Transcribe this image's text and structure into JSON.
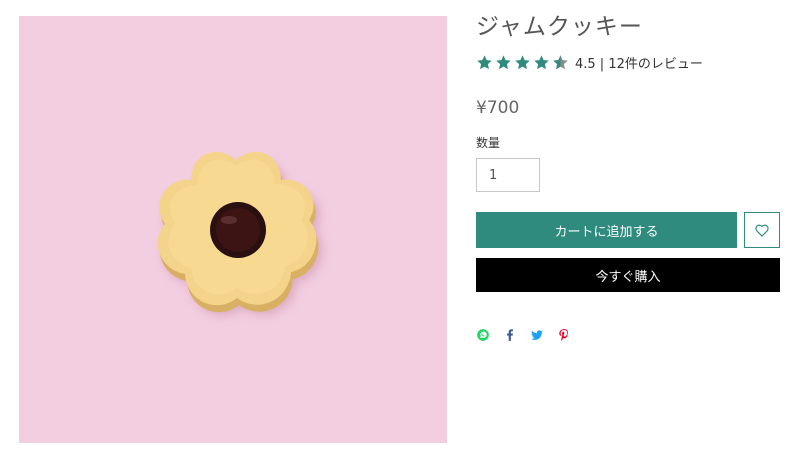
{
  "product": {
    "title": "ジャムクッキー",
    "rating_value": 4.5,
    "rating_text": "4.5 | 12件のレビュー",
    "price": "¥700",
    "quantity_label": "数量",
    "quantity_value": "1",
    "add_to_cart_label": "カートに追加する",
    "buy_now_label": "今すぐ購入"
  },
  "stars": [
    {
      "icon": "star-full-icon"
    },
    {
      "icon": "star-full-icon"
    },
    {
      "icon": "star-full-icon"
    },
    {
      "icon": "star-full-icon"
    },
    {
      "icon": "star-half-icon"
    }
  ],
  "share": [
    {
      "icon": "whatsapp-icon",
      "color": "#25d366"
    },
    {
      "icon": "facebook-icon",
      "color": "#3b5998"
    },
    {
      "icon": "twitter-icon",
      "color": "#1da1f2"
    },
    {
      "icon": "pinterest-icon",
      "color": "#e60023"
    }
  ],
  "colors": {
    "accent": "#2e8b7d",
    "image_background": "#f3cde0",
    "buy_now": "#000000",
    "star": "#2e8b7d"
  }
}
